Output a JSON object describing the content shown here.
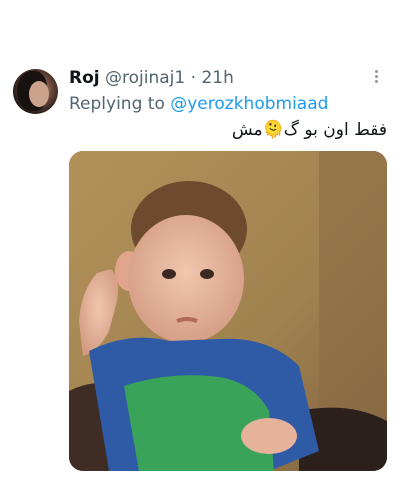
{
  "tweet": {
    "display_name": "Roj",
    "handle": "@rojinaj1",
    "separator": "·",
    "timestamp": "21h",
    "reply_prefix": "Replying to",
    "reply_to": "@yerozkhobmiaad",
    "text": "فقط اون بو گ🫠مش",
    "more_icon": "more-options-icon",
    "avatar": "profile-avatar",
    "media": "gif-thumbnail-boy-on-couch"
  }
}
